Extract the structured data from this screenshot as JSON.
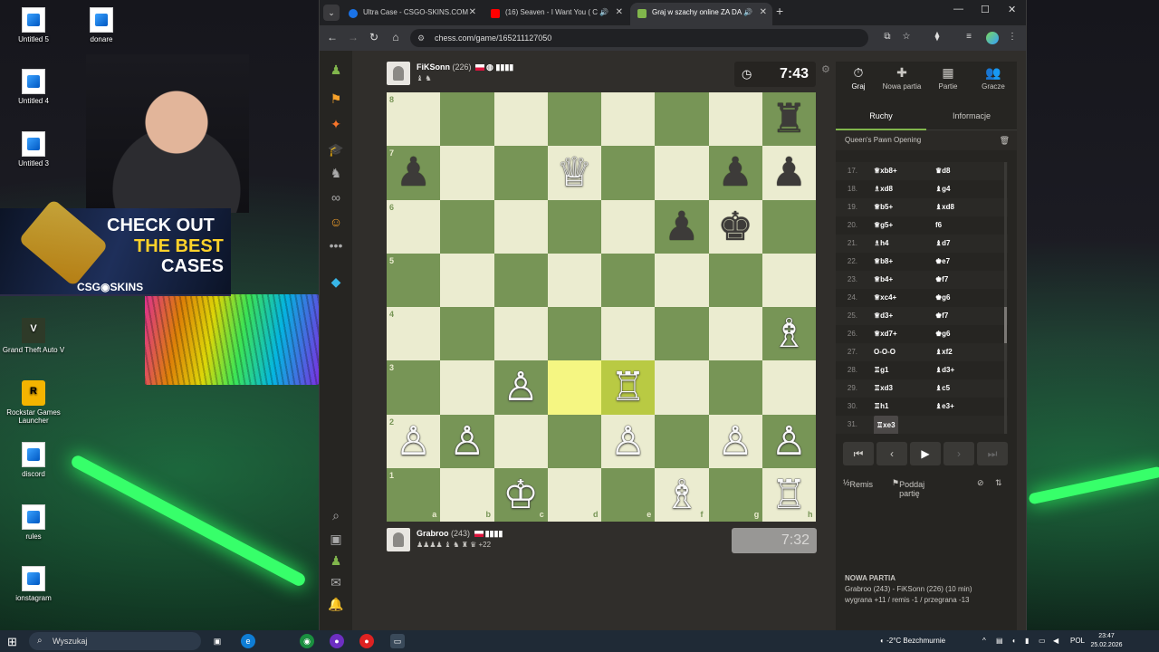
{
  "desktop": {
    "icons": [
      {
        "label": "Untitled 5"
      },
      {
        "label": "donare"
      },
      {
        "label": "Untitled 4"
      },
      {
        "label": "Untitled 3"
      },
      {
        "label": "Grand Theft Auto V"
      },
      {
        "label": "Rockstar Games Launcher"
      },
      {
        "label": "discord"
      },
      {
        "label": "rules"
      },
      {
        "label": "ionstagram"
      }
    ],
    "promo": {
      "line1": "CHECK OUT",
      "line2": "THE BEST",
      "line3": "CASES",
      "brand": "CSG◉SKINS"
    }
  },
  "browser": {
    "tabs": [
      {
        "title": "Ultra Case - CSGO-SKINS.COM",
        "color": "#1a73e8"
      },
      {
        "title": "(16) Seaven - I Want You ( C",
        "color": "#ff0000"
      },
      {
        "title": "Graj w szachy online ZA DA",
        "color": "#81b64c"
      }
    ],
    "url": "chess.com/game/165211127050"
  },
  "game": {
    "top_player": {
      "name": "FiKSonn",
      "rating": "(226)",
      "clock": "7:43"
    },
    "bottom_player": {
      "name": "Grabroo",
      "rating": "(243)",
      "captured_extra": "+22",
      "clock": "7:32"
    },
    "files": [
      "a",
      "b",
      "c",
      "d",
      "e",
      "f",
      "g",
      "h"
    ],
    "ranks": [
      "8",
      "7",
      "6",
      "5",
      "4",
      "3",
      "2",
      "1"
    ],
    "pieces": [
      {
        "sq": "h8",
        "c": "b",
        "p": "♜"
      },
      {
        "sq": "a7",
        "c": "b",
        "p": "♟"
      },
      {
        "sq": "d7",
        "c": "w",
        "p": "♕"
      },
      {
        "sq": "g7",
        "c": "b",
        "p": "♟"
      },
      {
        "sq": "h7",
        "c": "b",
        "p": "♟"
      },
      {
        "sq": "f6",
        "c": "b",
        "p": "♟"
      },
      {
        "sq": "g6",
        "c": "b",
        "p": "♚"
      },
      {
        "sq": "h4",
        "c": "w",
        "p": "♗"
      },
      {
        "sq": "c3",
        "c": "w",
        "p": "♙"
      },
      {
        "sq": "e3",
        "c": "w",
        "p": "♖"
      },
      {
        "sq": "a2",
        "c": "w",
        "p": "♙"
      },
      {
        "sq": "b2",
        "c": "w",
        "p": "♙"
      },
      {
        "sq": "e2",
        "c": "w",
        "p": "♙"
      },
      {
        "sq": "g2",
        "c": "w",
        "p": "♙"
      },
      {
        "sq": "h2",
        "c": "w",
        "p": "♙"
      },
      {
        "sq": "c1",
        "c": "w",
        "p": "♔"
      },
      {
        "sq": "f1",
        "c": "w",
        "p": "♗"
      },
      {
        "sq": "h1",
        "c": "w",
        "p": "♖"
      }
    ],
    "highlight": [
      "d3",
      "e3"
    ]
  },
  "panel": {
    "tabs": [
      {
        "icon": "⏱",
        "label": "Graj"
      },
      {
        "icon": "✚",
        "label": "Nowa partia"
      },
      {
        "icon": "▦",
        "label": "Partie"
      },
      {
        "icon": "👥",
        "label": "Gracze"
      }
    ],
    "subtabs": [
      "Ruchy",
      "Informacje"
    ],
    "opening": "Queen's Pawn Opening",
    "moves": [
      {
        "n": "17.",
        "w": "♕xb8+",
        "b": "♛d8"
      },
      {
        "n": "18.",
        "w": "♗xd8",
        "b": "♝g4"
      },
      {
        "n": "19.",
        "w": "♕b5+",
        "b": "♝xd8"
      },
      {
        "n": "20.",
        "w": "♕g5+",
        "b": "f6"
      },
      {
        "n": "21.",
        "w": "♗h4",
        "b": "♝d7"
      },
      {
        "n": "22.",
        "w": "♕b8+",
        "b": "♚e7"
      },
      {
        "n": "23.",
        "w": "♕b4+",
        "b": "♚f7"
      },
      {
        "n": "24.",
        "w": "♕xc4+",
        "b": "♚g6"
      },
      {
        "n": "25.",
        "w": "♕d3+",
        "b": "♚f7"
      },
      {
        "n": "26.",
        "w": "♕xd7+",
        "b": "♚g6"
      },
      {
        "n": "27.",
        "w": "O-O-O",
        "b": "♝xf2"
      },
      {
        "n": "28.",
        "w": "♖g1",
        "b": "♝d3+"
      },
      {
        "n": "29.",
        "w": "♖xd3",
        "b": "♝c5"
      },
      {
        "n": "30.",
        "w": "♖h1",
        "b": "♝e3+"
      },
      {
        "n": "31.",
        "w": "♖xe3",
        "b": ""
      }
    ],
    "actions": {
      "draw": "Remis",
      "resign": "Poddaj partię"
    },
    "new_game": {
      "title": "NOWA PARTIA",
      "line1": "Grabroo (243) - FiKSonn (226) (10 min)",
      "line2": "wygrana +11 / remis -1 / przegrana -13"
    }
  },
  "taskbar": {
    "search": "Wyszukaj",
    "weather": "-2°C  Bezchmurnie",
    "lang": "POL",
    "time": "23:47",
    "date": "25.02.2026"
  }
}
